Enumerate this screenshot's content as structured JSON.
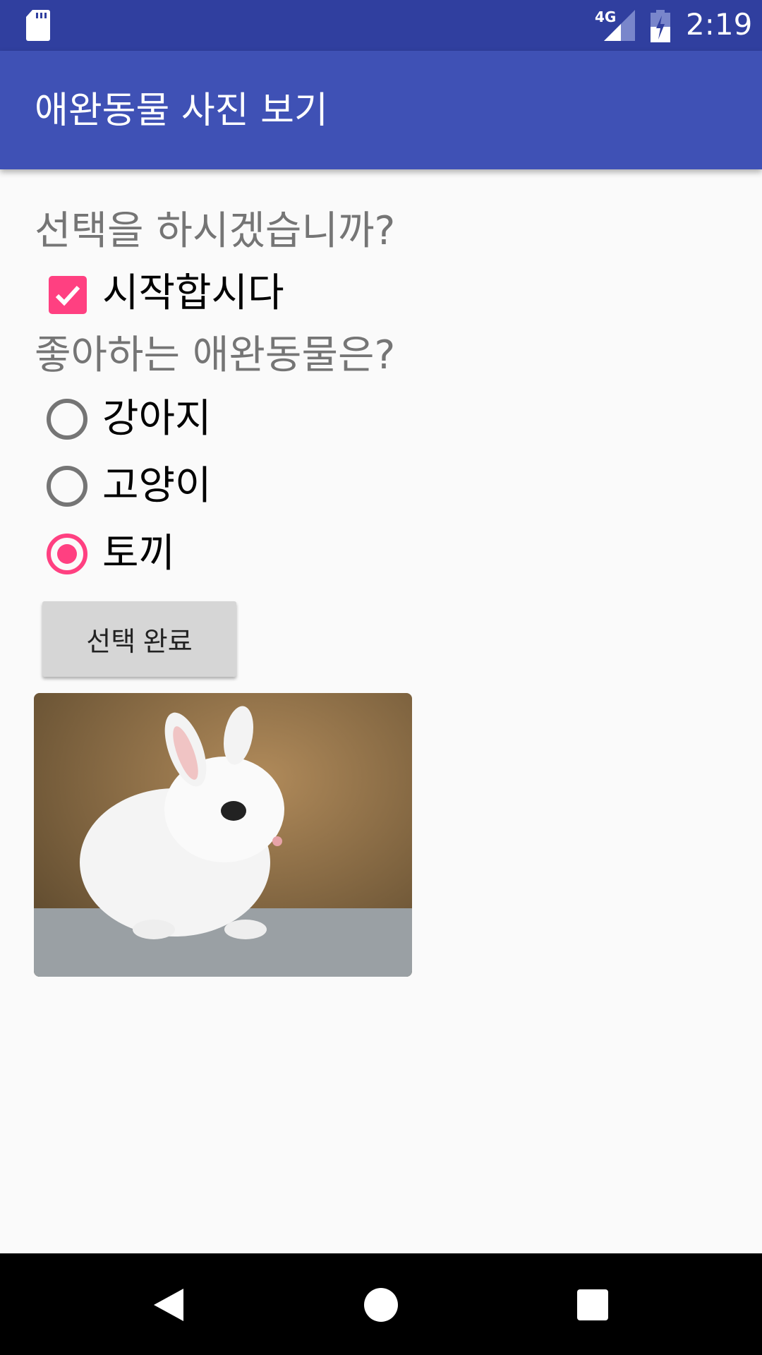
{
  "status_bar": {
    "time": "2:19",
    "network": "4G",
    "icons": [
      "sd-card-icon",
      "signal-icon",
      "battery-charging-icon"
    ]
  },
  "app_bar": {
    "title": "애완동물 사진 보기"
  },
  "main": {
    "question1": "선택을 하시겠습니까?",
    "checkbox": {
      "label": "시작합시다",
      "checked": true
    },
    "question2": "좋아하는 애완동물은?",
    "radios": [
      {
        "label": "강아지",
        "selected": false
      },
      {
        "label": "고양이",
        "selected": false
      },
      {
        "label": "토끼",
        "selected": true
      }
    ],
    "button_label": "선택 완료",
    "image": "rabbit-photo"
  },
  "colors": {
    "primary": "#3f51b5",
    "primary_dark": "#303f9f",
    "accent": "#ff4081"
  },
  "nav_bar": {
    "icons": [
      "back-icon",
      "home-icon",
      "recents-icon"
    ]
  }
}
